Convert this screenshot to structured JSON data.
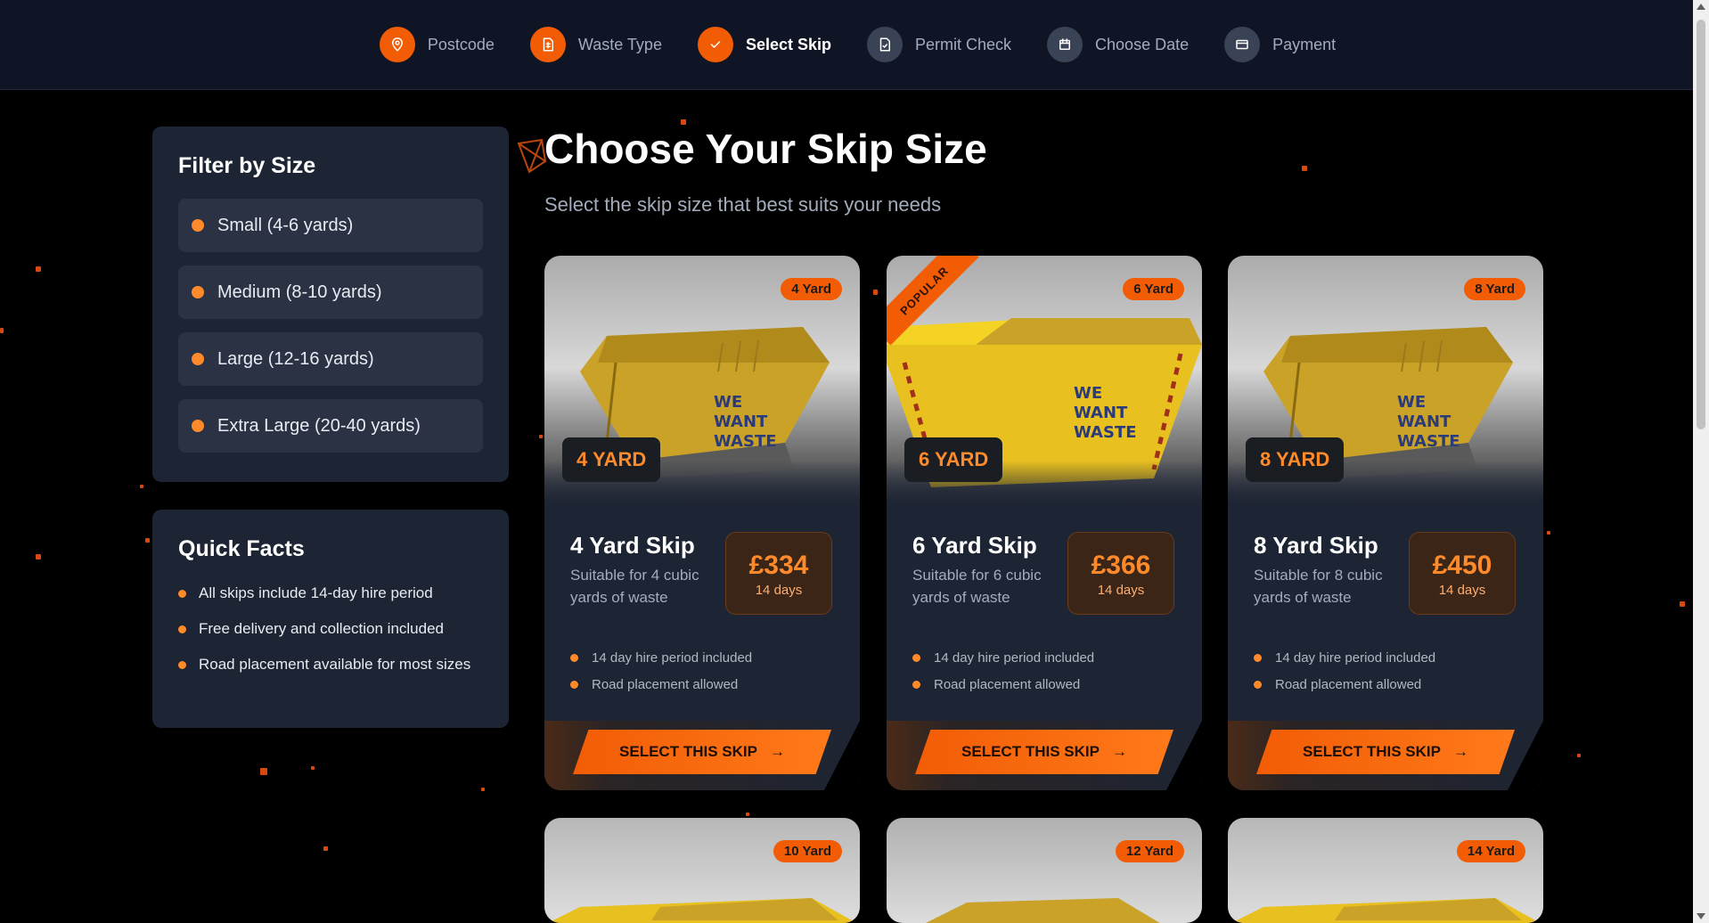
{
  "stepper": [
    {
      "label": "Postcode",
      "icon": "map-pin-icon",
      "state": "done"
    },
    {
      "label": "Waste Type",
      "icon": "trash-icon",
      "state": "done"
    },
    {
      "label": "Select Skip",
      "icon": "check-icon",
      "state": "current"
    },
    {
      "label": "Permit Check",
      "icon": "file-check-icon",
      "state": "upcoming"
    },
    {
      "label": "Choose Date",
      "icon": "calendar-icon",
      "state": "upcoming"
    },
    {
      "label": "Payment",
      "icon": "credit-card-icon",
      "state": "upcoming"
    }
  ],
  "filter": {
    "title": "Filter by Size",
    "items": [
      "Small (4-6 yards)",
      "Medium (8-10 yards)",
      "Large (12-16 yards)",
      "Extra Large (20-40 yards)"
    ]
  },
  "facts": {
    "title": "Quick Facts",
    "items": [
      "All skips include 14-day hire period",
      "Free delivery and collection included",
      "Road placement available for most sizes"
    ]
  },
  "heading": {
    "title": "Choose Your Skip Size",
    "subtitle": "Select the skip size that best suits your needs"
  },
  "cards": [
    {
      "badge": "4 Yard",
      "tag": "4 YARD",
      "name": "4 Yard Skip",
      "desc": "Suitable for 4 cubic yards of waste",
      "price": "£334",
      "period": "14 days",
      "features": [
        "14 day hire period included",
        "Road placement allowed"
      ],
      "button": "SELECT THIS SKIP",
      "popular": false
    },
    {
      "badge": "6 Yard",
      "tag": "6 YARD",
      "name": "6 Yard Skip",
      "desc": "Suitable for 6 cubic yards of waste",
      "price": "£366",
      "period": "14 days",
      "features": [
        "14 day hire period included",
        "Road placement allowed"
      ],
      "button": "SELECT THIS SKIP",
      "popular": true,
      "popular_label": "POPULAR"
    },
    {
      "badge": "8 Yard",
      "tag": "8 YARD",
      "name": "8 Yard Skip",
      "desc": "Suitable for 8 cubic yards of waste",
      "price": "£450",
      "period": "14 days",
      "features": [
        "14 day hire period included",
        "Road placement allowed"
      ],
      "button": "SELECT THIS SKIP",
      "popular": false
    },
    {
      "badge": "10 Yard"
    },
    {
      "badge": "12 Yard"
    },
    {
      "badge": "14 Yard"
    }
  ],
  "skip_logo": "WE WANT WASTE",
  "colors": {
    "accent": "#f25c05",
    "panel": "#1d2433",
    "header": "#0f1524"
  }
}
